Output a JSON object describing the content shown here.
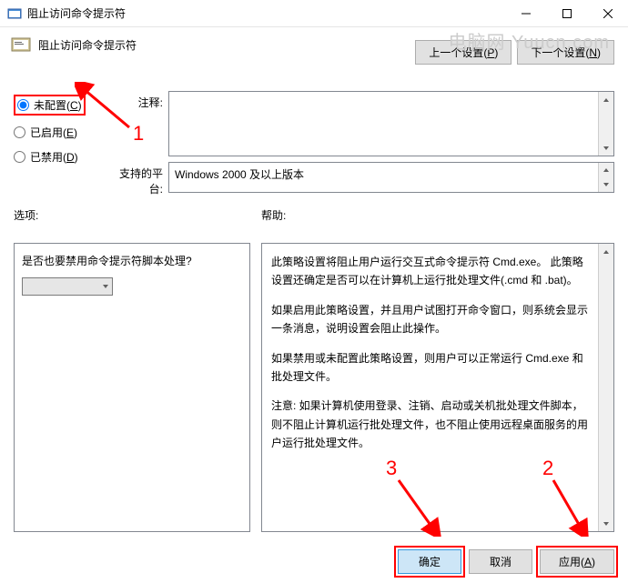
{
  "window": {
    "title": "阻止访问命令提示符"
  },
  "header": {
    "title": "阻止访问命令提示符"
  },
  "nav": {
    "prev": "上一个设置(P)",
    "next": "下一个设置(N)",
    "prev_key": "P",
    "next_key": "N"
  },
  "radios": {
    "not_configured": "未配置(C)",
    "not_configured_key": "C",
    "enabled": "已启用(E)",
    "enabled_key": "E",
    "disabled": "已禁用(D)",
    "disabled_key": "D"
  },
  "labels": {
    "comment": "注释:",
    "platform": "支持的平台:",
    "options": "选项:",
    "help": "帮助:"
  },
  "platform_text": "Windows 2000 及以上版本",
  "options": {
    "question": "是否也要禁用命令提示符脚本处理?"
  },
  "help": {
    "p1": "此策略设置将阻止用户运行交互式命令提示符 Cmd.exe。 此策略设置还确定是否可以在计算机上运行批处理文件(.cmd 和 .bat)。",
    "p2": "如果启用此策略设置，并且用户试图打开命令窗口，则系统会显示一条消息，说明设置会阻止此操作。",
    "p3": "如果禁用或未配置此策略设置，则用户可以正常运行 Cmd.exe 和批处理文件。",
    "p4": "注意: 如果计算机使用登录、注销、启动或关机批处理文件脚本，则不阻止计算机运行批处理文件，也不阻止使用远程桌面服务的用户运行批处理文件。"
  },
  "buttons": {
    "ok": "确定",
    "cancel": "取消",
    "apply": "应用(A)",
    "apply_key": "A"
  },
  "annotations": {
    "a1": "1",
    "a2": "2",
    "a3": "3"
  },
  "watermark": "电脑网 Yuucn.com"
}
